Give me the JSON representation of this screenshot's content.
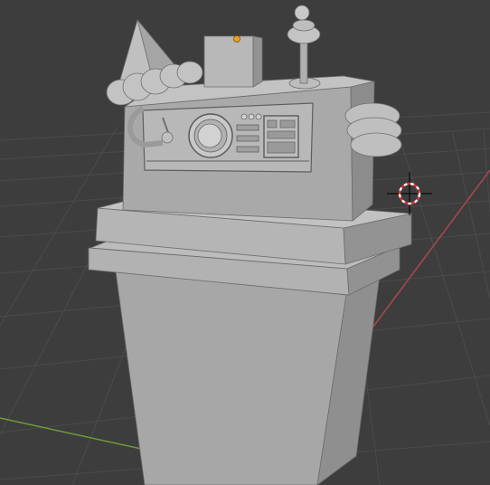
{
  "viewport": {
    "kind": "3D viewport",
    "shading": "solid",
    "background_color": "#3d3d3d",
    "grid_color": "#4b4b4b",
    "x_axis_color": "#b0454f",
    "y_axis_color": "#6f9a3a"
  },
  "scene": {
    "object_color": "#a9a9a9",
    "object_shadow_color": "#8a8a8a",
    "object_highlight_color": "#c4c4c4",
    "origin_marker_color": "#f0a020",
    "cursor_icon": "3d-cursor-icon",
    "cursor_colors": [
      "#ffffff",
      "#e03030"
    ]
  }
}
